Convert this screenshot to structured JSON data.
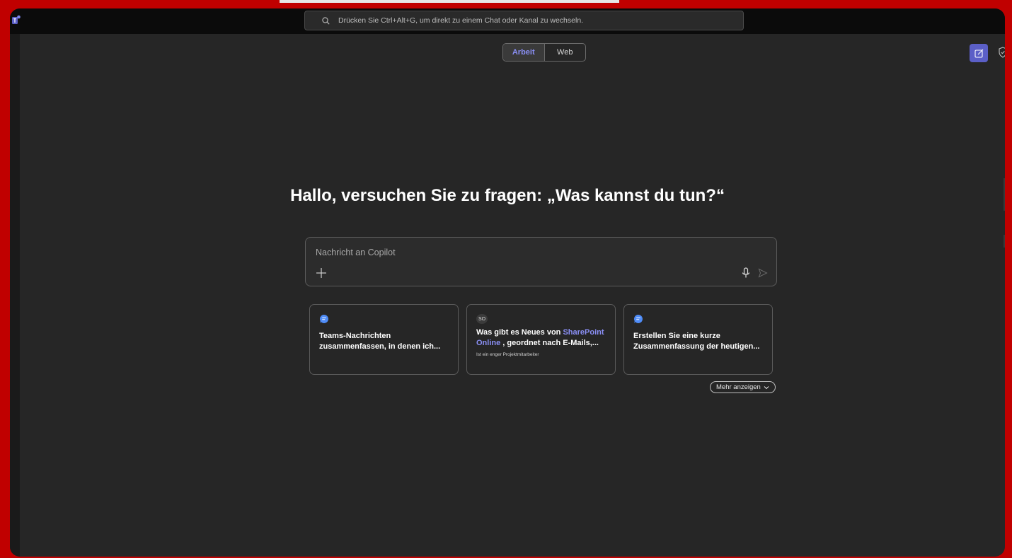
{
  "search": {
    "placeholder": "Drücken Sie Ctrl+Alt+G, um direkt zu einem Chat oder Kanal zu wechseln."
  },
  "tabs": [
    {
      "label": "Arbeit",
      "active": true
    },
    {
      "label": "Web",
      "active": false
    }
  ],
  "headline": "Hallo, versuchen Sie zu fragen: „Was kannst du tun?“",
  "composer": {
    "placeholder": "Nachricht an Copilot"
  },
  "cards": [
    {
      "icon": "chat-bubble-icon",
      "text": "Teams-Nachrichten zusammenfassen, in denen ich..."
    },
    {
      "badge": "SO",
      "text_before": "Was gibt es Neues von ",
      "link": "SharePoint Online",
      "text_after": " , geordnet nach E-Mails,...",
      "subtext": "Ist ein enger Projektmitarbeiter"
    },
    {
      "icon": "chat-bubble-icon",
      "text": "Erstellen Sie eine kurze Zusammenfassung der heutigen..."
    }
  ],
  "more": {
    "label": "Mehr anzeigen"
  },
  "colors": {
    "accent": "#5b5fc7",
    "link": "#8a8ff5",
    "frame": "#c00000",
    "background": "#262626"
  }
}
